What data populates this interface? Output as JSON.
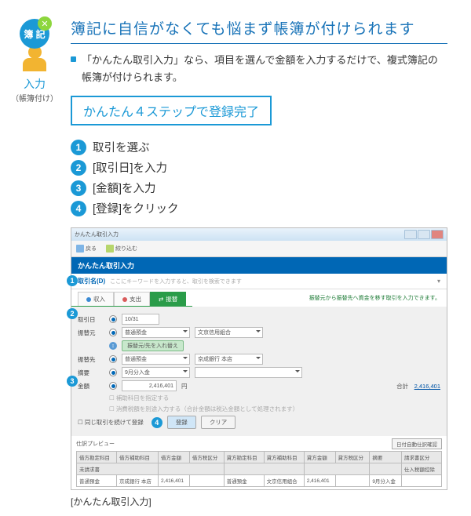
{
  "left": {
    "label": "入力",
    "sub": "（帳簿付け）"
  },
  "title": "簿記に自信がなくても悩まず帳簿が付けられます",
  "desc": "「かんたん取引入力」なら、項目を選んで金額を入力するだけで、複式簿記の帳簿が付けられます。",
  "badge": "かんたん４ステップで登録完了",
  "steps": [
    "取引を選ぶ",
    "[取引日]を入力",
    "[金額]を入力",
    "[登録]をクリック"
  ],
  "window": {
    "title": "かんたん取引入力",
    "toolbar": {
      "back": "戻る",
      "edit": "絞り込む"
    },
    "panel": "かんたん取引入力",
    "search": {
      "label": "取引名(D)",
      "hint": "ここにキーワードを入力すると、取引を検索できます"
    },
    "tabs": {
      "income": "収入",
      "expense": "支出",
      "transfer": "振替"
    },
    "actions_hint": "振替元から振替先へ資金を移す取引を入力できます。",
    "form": {
      "date_l": "取引日",
      "date_v": "10/31",
      "from_l": "振替元",
      "from_account": "普通預金",
      "from_sub": "文京信用組合",
      "indent": "振替元/先を入れ替え",
      "to_l": "振替先",
      "to_account": "普通預金",
      "to_sub": "京成銀行 本店",
      "summary_l": "摘要",
      "summary_v": "9月分入金",
      "amount_l": "金額",
      "amount_v": "2,416,401",
      "amount_suffix": "円",
      "total_l": "合計",
      "total_v": "2,416,401",
      "chk1": "補助科目を指定する",
      "chk2": "消費税額を別途入力する（合計金額は税込金額として処理されます）",
      "chk_same": "同じ取引を続けて登録",
      "register": "登録",
      "clear": "クリア"
    },
    "preview": {
      "title": "仕訳プレビュー",
      "auto": "日付自動仕訳確認",
      "headers": [
        "借方勘定科目",
        "借方補助科目",
        "借方金額",
        "借方税区分",
        "貸方勘定科目",
        "貸方補助科目",
        "貸方金額",
        "貸方税区分",
        "摘要",
        "請求書区分"
      ],
      "h2l": "未請求書",
      "h2r": "仕入税額控除",
      "rows": [
        [
          "普通預金",
          "京成銀行 本店",
          "2,416,401",
          "",
          "普通預金",
          "文京信用組合",
          "2,416,401",
          "",
          "9月分入金",
          ""
        ]
      ]
    }
  },
  "caption": "[かんたん取引入力]"
}
